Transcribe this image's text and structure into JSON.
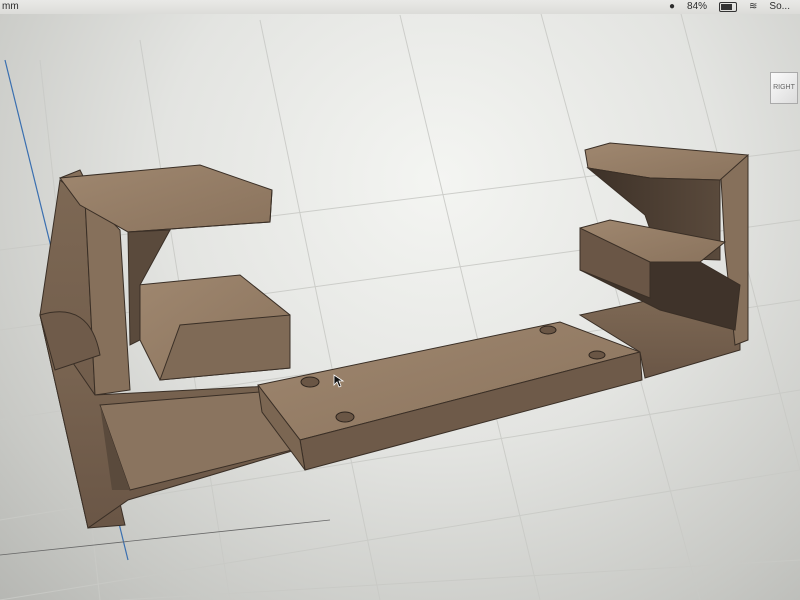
{
  "menubar": {
    "units": "mm",
    "battery": "84%",
    "top_right_label": "So..."
  },
  "viewcube": {
    "face_label": "RIGHT"
  },
  "colors": {
    "model_top": "#917a64",
    "model_side": "#7a6552",
    "model_dark": "#4a3c30",
    "grid_line": "#c6c7c3",
    "axis_blue": "#3a6fb0"
  },
  "icons": [
    "apple-icon",
    "battery-icon",
    "wifi-icon",
    "cursor-pointer-icon"
  ]
}
